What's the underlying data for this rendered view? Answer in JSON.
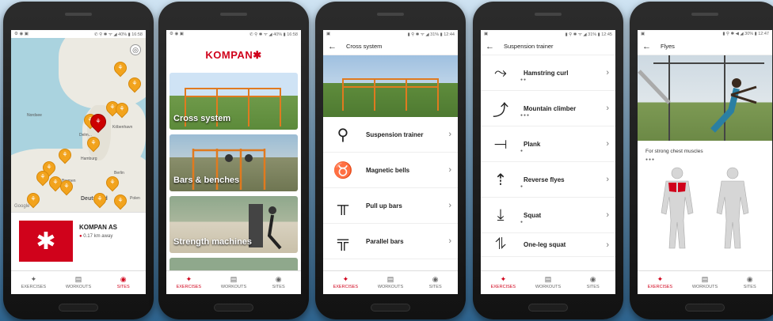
{
  "phones": [
    {
      "status": {
        "left": "⚙ ◉ ▣",
        "right": "✆ ⚲ ✱ ᯤ ◢ 40% ▮ 16:58"
      },
      "map": {
        "labels": {
          "north_sea": "Nordsee",
          "city_west": "Delm...",
          "city_east": "Köbenhavn",
          "hamburg": "Hamburg",
          "berlin": "Berlin",
          "bremen": "Bremen",
          "deutschland": "Deutsland",
          "polen": "Polen",
          "google": "Google",
          "osl": "Oslo"
        }
      },
      "card": {
        "name": "KOMPAN AS",
        "distance": "0.17 km away"
      },
      "tabs": [
        "EXERCISES",
        "WORKOUTS",
        "SITES"
      ],
      "active_tab": 2
    },
    {
      "status": {
        "left": "⚙ ◉ ▣",
        "right": "✆ ⚲ ✱ ᯤ ◢ 40% ▮ 16:58"
      },
      "brand": "KOMPAN",
      "items": [
        "Cross system",
        "Bars & benches",
        "Strength machines"
      ],
      "tabs": [
        "EXERCISES",
        "WORKOUTS",
        "SITES"
      ],
      "active_tab": 0
    },
    {
      "status": {
        "left": "▣",
        "right": "▮ ⚲ ✱ ᯤ ◢ 31% ▮ 12:44"
      },
      "title": "Cross system",
      "items": [
        "Suspension trainer",
        "Magnetic bells",
        "Pull up bars",
        "Parallel bars"
      ],
      "tabs": [
        "EXERCISES",
        "WORKOUTS",
        "SITES"
      ],
      "active_tab": 0
    },
    {
      "status": {
        "left": "▣",
        "right": "▮ ⚲ ✱ ᯤ ◢ 31% ▮ 12:45"
      },
      "title": "Suspension trainer",
      "items": [
        "Hamstring curl",
        "Mountain climber",
        "Plank",
        "Reverse flyes",
        "Squat",
        "One-leg squat"
      ],
      "tabs": [
        "EXERCISES",
        "WORKOUTS",
        "SITES"
      ],
      "active_tab": 0
    },
    {
      "status": {
        "left": "▣",
        "right": "▮ ⚲ ✱ ◀ ◢ 30% ▮ 12:47"
      },
      "title": "Flyes",
      "subtitle": "For strong chest muscles",
      "tabs": [
        "EXERCISES",
        "WORKOUTS",
        "SITES"
      ],
      "active_tab": 0
    }
  ],
  "colors": {
    "accent": "#d0021b",
    "pin": "#f2a31d"
  }
}
